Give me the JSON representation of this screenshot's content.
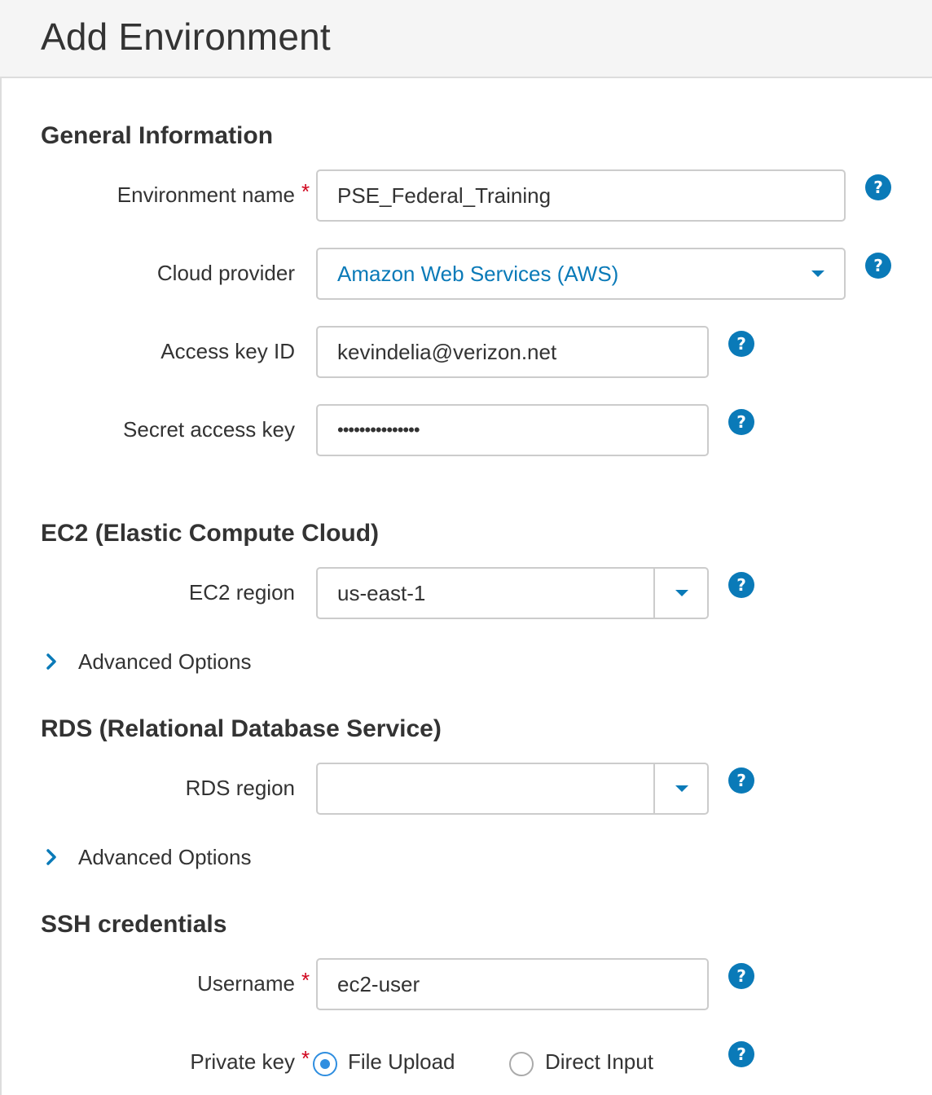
{
  "page": {
    "title": "Add Environment"
  },
  "sections": {
    "general": "General Information",
    "ec2": "EC2 (Elastic Compute Cloud)",
    "rds": "RDS (Relational Database Service)",
    "ssh": "SSH credentials"
  },
  "fields": {
    "environment_name": {
      "label": "Environment name",
      "required_mark": "*",
      "value": "PSE_Federal_Training"
    },
    "cloud_provider": {
      "label": "Cloud provider",
      "value": "Amazon Web Services (AWS)"
    },
    "access_key_id": {
      "label": "Access key ID",
      "value": "kevindelia@verizon.net"
    },
    "secret_access_key": {
      "label": "Secret access key",
      "value": "•••••••••••••••"
    },
    "ec2_region": {
      "label": "EC2 region",
      "value": "us-east-1"
    },
    "rds_region": {
      "label": "RDS region",
      "value": ""
    },
    "username": {
      "label": "Username",
      "required_mark": "*",
      "value": "ec2-user"
    },
    "private_key": {
      "label": "Private key",
      "required_mark": "*",
      "options": [
        {
          "label": "File Upload",
          "selected": true
        },
        {
          "label": "Direct Input",
          "selected": false
        }
      ]
    }
  },
  "advanced_options_label": "Advanced Options",
  "help_glyph": "?",
  "icons": {
    "help": "help-icon",
    "caret": "caret-down-icon",
    "chevron": "chevron-right-icon"
  },
  "colors": {
    "accent": "#0a7ab8",
    "required": "#d0021b",
    "radio": "#2f8ee0"
  }
}
